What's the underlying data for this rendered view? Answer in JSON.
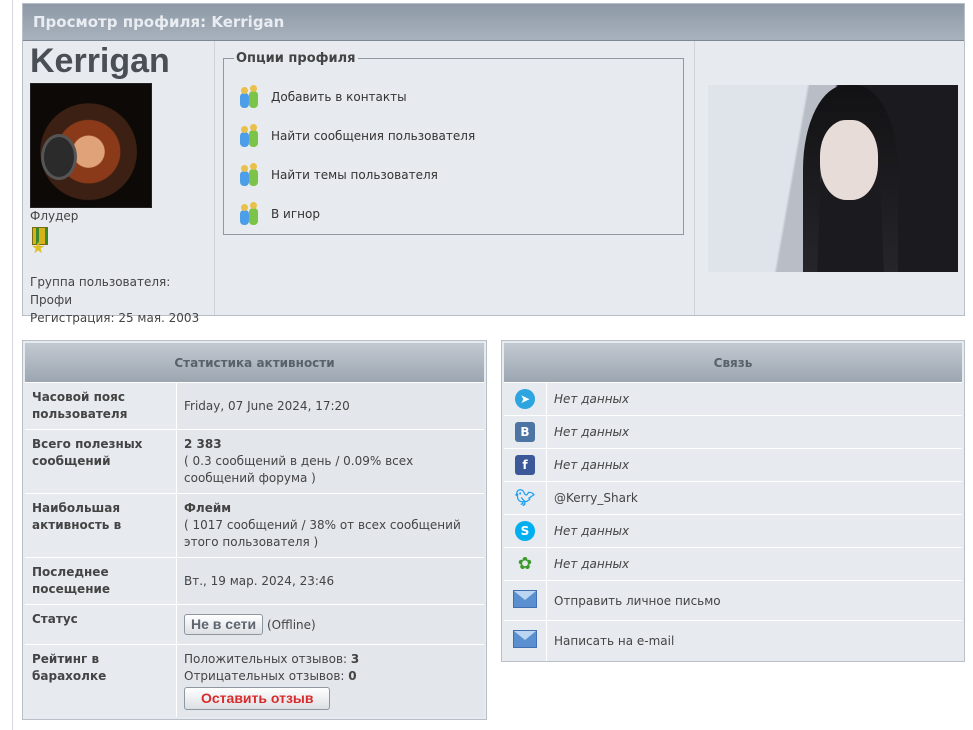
{
  "profile": {
    "header": "Просмотр профиля: Kerrigan",
    "username": "Kerrigan",
    "rank": "Флудер",
    "group_line": "Группа пользователя: Профи",
    "reg_line": "Регистрация: 25 мая. 2003",
    "options_title": "Опции профиля",
    "options": [
      "Добавить в контакты",
      "Найти сообщения пользователя",
      "Найти темы пользователя",
      "В игнор"
    ]
  },
  "stats": {
    "title": "Статистика активности",
    "rows": [
      {
        "label": "Часовой пояс пользователя",
        "value": "Friday, 07 June 2024, 17:20"
      },
      {
        "label": "Всего полезных сообщений",
        "bold": "2 383",
        "value": "( 0.3 сообщений в день / 0.09% всех сообщений форума )"
      },
      {
        "label": "Наибольшая активность в",
        "bold": "Флейм",
        "value": "( 1017 сообщений / 38% от всех сообщений этого пользователя )"
      },
      {
        "label": "Последнее посещение",
        "value": "Вт., 19 мар. 2024, 23:46"
      }
    ],
    "status_label": "Статус",
    "status_button": "Не в сети",
    "status_text": "(Offline)",
    "rating_label": "Рейтинг в барахолке",
    "positive_label": "Положительных отзывов:",
    "positive_value": "3",
    "negative_label": "Отрицательных отзывов:",
    "negative_value": "0",
    "review_button": "Оставить отзыв"
  },
  "contact": {
    "title": "Связь",
    "rows": [
      {
        "icon": "telegram-icon",
        "value": "Нет данных",
        "color": "#2ca5e0"
      },
      {
        "icon": "vk-icon",
        "value": "Нет данных",
        "color": "#4c75a3"
      },
      {
        "icon": "facebook-icon",
        "value": "Нет данных",
        "color": "#3b5998"
      },
      {
        "icon": "twitter-icon",
        "value": "@Kerry_Shark",
        "color": "#1da1f2"
      },
      {
        "icon": "skype-icon",
        "value": "Нет данных",
        "color": "#00aff0"
      },
      {
        "icon": "icq-icon",
        "value": "Нет данных",
        "color": "#3a9a2a"
      },
      {
        "icon": "mail-icon",
        "value": "Отправить личное письмо"
      },
      {
        "icon": "email-icon",
        "value": "Написать на e-mail"
      }
    ]
  }
}
